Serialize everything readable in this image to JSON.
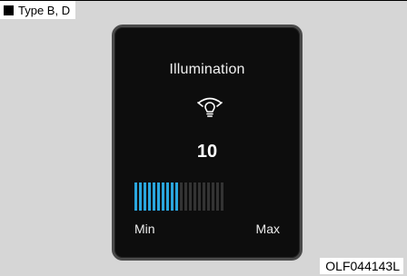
{
  "header": {
    "type_label": "Type B, D"
  },
  "display": {
    "title": "Illumination",
    "icon": "illumination-bulb-icon",
    "value": "10",
    "level": 10,
    "level_max": 20,
    "min_label": "Min",
    "max_label": "Max",
    "accent_color": "#2aa6de",
    "inactive_color": "#333333"
  },
  "footer": {
    "figure_code": "OLF044143L"
  }
}
